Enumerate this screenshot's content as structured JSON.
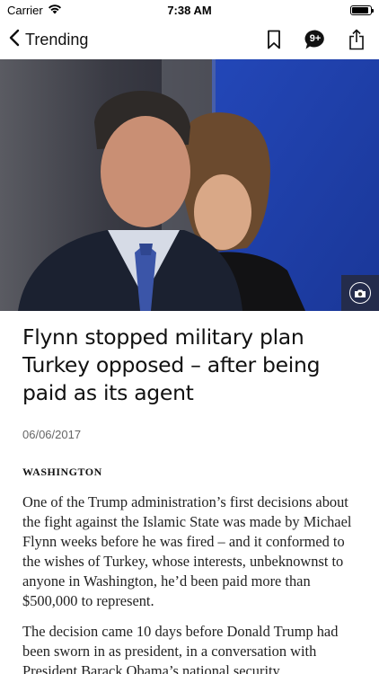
{
  "status_bar": {
    "carrier": "Carrier",
    "time": "7:38 AM",
    "battery_level": 0.9
  },
  "nav": {
    "back_label": "Trending",
    "back_icon": "chevron-left-icon",
    "bookmark_icon": "bookmark-icon",
    "comments_icon": "comment-bubble-icon",
    "comments_count": "9+",
    "share_icon": "share-icon"
  },
  "hero": {
    "camera_icon": "camera-icon"
  },
  "article": {
    "headline": "Flynn stopped military plan Turkey opposed – after being paid as its agent",
    "date": "06/06/2017",
    "dateline": "WASHINGTON",
    "paragraphs": [
      "One of the Trump administration’s first decisions about the fight against the Islamic State was made by Michael Flynn weeks before he was fired – and it conformed to the wishes of Turkey, whose interests, unbeknownst to anyone in Washington, he’d been paid more than $500,000 to represent.",
      "The decision came 10 days before Donald Trump had been sworn in as president, in a conversation with President Barack Obama’s national security"
    ]
  }
}
